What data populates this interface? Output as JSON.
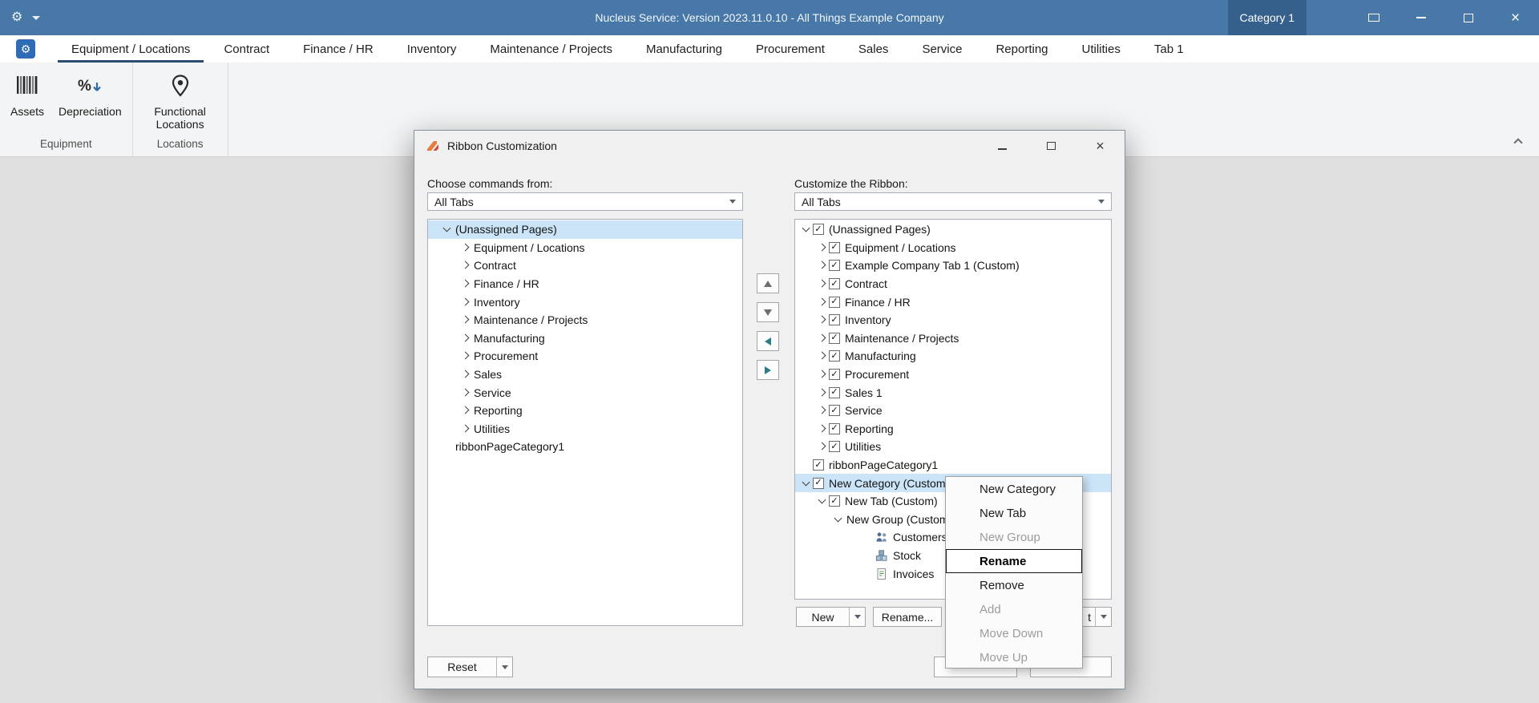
{
  "colors": {
    "titlebar": "#4878a8",
    "category_badge": "#35608c",
    "selection": "#cbe4f7",
    "active_tab_underline": "#2b4d71"
  },
  "titlebar": {
    "title": "Nucleus Service: Version 2023.11.0.10 - All Things Example Company",
    "category_badge": "Category 1"
  },
  "tabbar": {
    "tabs": [
      {
        "label": "Equipment / Locations",
        "active": true
      },
      {
        "label": "Contract"
      },
      {
        "label": "Finance / HR"
      },
      {
        "label": "Inventory"
      },
      {
        "label": "Maintenance / Projects"
      },
      {
        "label": "Manufacturing"
      },
      {
        "label": "Procurement"
      },
      {
        "label": "Sales"
      },
      {
        "label": "Service"
      },
      {
        "label": "Reporting"
      },
      {
        "label": "Utilities"
      },
      {
        "label": "Tab 1"
      }
    ]
  },
  "ribbon": {
    "groups": [
      {
        "label": "Equipment",
        "items": [
          {
            "label": "Assets",
            "icon": "barcode"
          },
          {
            "label": "Depreciation",
            "icon": "percent-down"
          }
        ]
      },
      {
        "label": "Locations",
        "items": [
          {
            "label": "Functional Locations",
            "icon": "location-pin"
          }
        ]
      }
    ]
  },
  "dialog": {
    "title": "Ribbon Customization",
    "choose_label": "Choose commands from:",
    "choose_dropdown": "All Tabs",
    "customize_label": "Customize the Ribbon:",
    "customize_dropdown": "All Tabs",
    "commands_tree": [
      {
        "label": "(Unassigned Pages)",
        "level": 0,
        "chevron": "down",
        "selected": true
      },
      {
        "label": "Equipment / Locations",
        "level": 1,
        "chevron": "right"
      },
      {
        "label": "Contract",
        "level": 1,
        "chevron": "right"
      },
      {
        "label": "Finance / HR",
        "level": 1,
        "chevron": "right"
      },
      {
        "label": "Inventory",
        "level": 1,
        "chevron": "right"
      },
      {
        "label": "Maintenance / Projects",
        "level": 1,
        "chevron": "right"
      },
      {
        "label": "Manufacturing",
        "level": 1,
        "chevron": "right"
      },
      {
        "label": "Procurement",
        "level": 1,
        "chevron": "right"
      },
      {
        "label": "Sales",
        "level": 1,
        "chevron": "right"
      },
      {
        "label": "Service",
        "level": 1,
        "chevron": "right"
      },
      {
        "label": "Reporting",
        "level": 1,
        "chevron": "right"
      },
      {
        "label": "Utilities",
        "level": 1,
        "chevron": "right"
      },
      {
        "label": "ribbonPageCategory1",
        "level": 0
      }
    ],
    "customize_tree": [
      {
        "label": "(Unassigned Pages)",
        "level": 0,
        "chevron": "down",
        "checked": true
      },
      {
        "label": "Equipment / Locations",
        "level": 1,
        "chevron": "right",
        "checked": true
      },
      {
        "label": "Example Company Tab 1 (Custom)",
        "level": 1,
        "chevron": "right",
        "checked": true
      },
      {
        "label": "Contract",
        "level": 1,
        "chevron": "right",
        "checked": true
      },
      {
        "label": "Finance / HR",
        "level": 1,
        "chevron": "right",
        "checked": true
      },
      {
        "label": "Inventory",
        "level": 1,
        "chevron": "right",
        "checked": true
      },
      {
        "label": "Maintenance / Projects",
        "level": 1,
        "chevron": "right",
        "checked": true
      },
      {
        "label": "Manufacturing",
        "level": 1,
        "chevron": "right",
        "checked": true
      },
      {
        "label": "Procurement",
        "level": 1,
        "chevron": "right",
        "checked": true
      },
      {
        "label": "Sales 1",
        "level": 1,
        "chevron": "right",
        "checked": true
      },
      {
        "label": "Service",
        "level": 1,
        "chevron": "right",
        "checked": true
      },
      {
        "label": "Reporting",
        "level": 1,
        "chevron": "right",
        "checked": true
      },
      {
        "label": "Utilities",
        "level": 1,
        "chevron": "right",
        "checked": true
      },
      {
        "label": "ribbonPageCategory1",
        "level": 0,
        "checked": true
      },
      {
        "label": "New Category (Custom)",
        "level": 0,
        "chevron": "down",
        "checked": true,
        "selected": true
      },
      {
        "label": "New Tab (Custom)",
        "level": 1,
        "chevron": "down",
        "checked": true
      },
      {
        "label": "New Group (Custom)",
        "level": 2,
        "chevron": "down"
      },
      {
        "label": "Customers",
        "level": 3,
        "icon": "customers"
      },
      {
        "label": "Stock",
        "level": 3,
        "icon": "stock"
      },
      {
        "label": "Invoices",
        "level": 3,
        "icon": "invoices"
      }
    ],
    "action_buttons": {
      "new": "New",
      "rename": "Rename...",
      "partial_visible": "t"
    },
    "footer": {
      "reset": "Reset"
    }
  },
  "context_menu": {
    "items": [
      {
        "label": "New Category"
      },
      {
        "label": "New Tab"
      },
      {
        "label": "New Group",
        "disabled": true
      },
      {
        "label": "Rename",
        "focused": true
      },
      {
        "label": "Remove"
      },
      {
        "label": "Add",
        "disabled": true
      },
      {
        "label": "Move Down",
        "disabled": true
      },
      {
        "label": "Move Up",
        "disabled": true
      }
    ]
  }
}
